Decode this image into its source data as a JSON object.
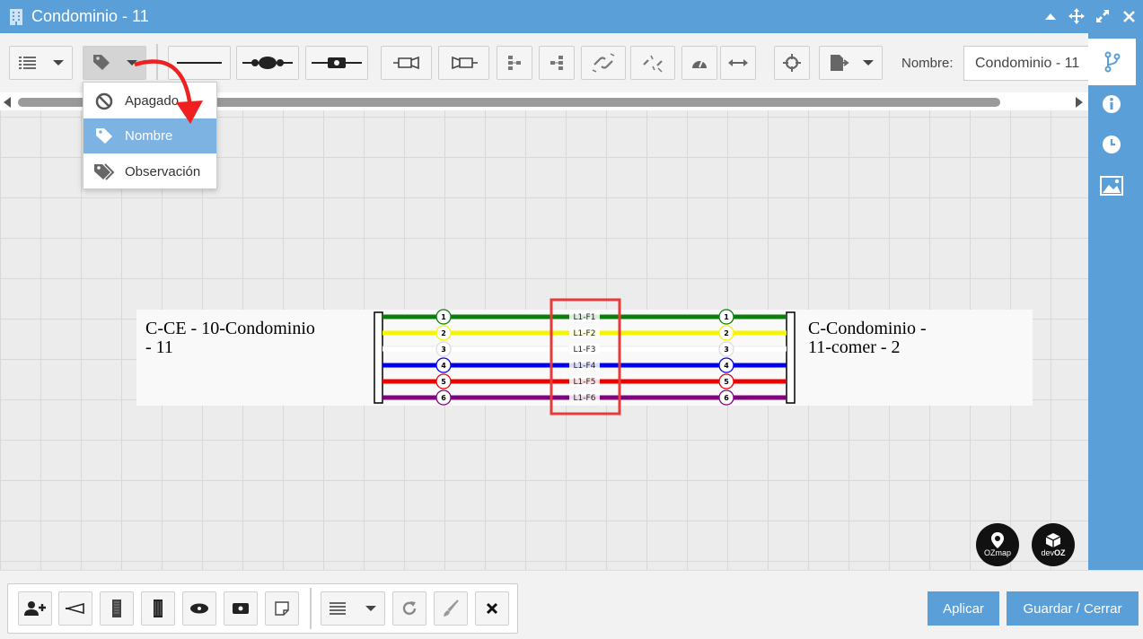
{
  "window": {
    "title": "Condominio - 11"
  },
  "toolbar": {
    "name_label": "Nombre:",
    "name_value": "Condominio - 11"
  },
  "dropdown": {
    "items": [
      {
        "label": "Apagado"
      },
      {
        "label": "Nombre"
      },
      {
        "label": "Observación"
      }
    ]
  },
  "diagram": {
    "left_label": [
      "C-CE - 10-Condominio",
      "- 11"
    ],
    "right_label": [
      "C-Condominio -",
      "11-comer - 2"
    ],
    "fibers": [
      {
        "num": "1",
        "name": "L1-F1",
        "color": "#0a7d0a"
      },
      {
        "num": "2",
        "name": "L1-F2",
        "color": "#f5f500"
      },
      {
        "num": "3",
        "name": "L1-F3",
        "color": "#ffffff"
      },
      {
        "num": "4",
        "name": "L1-F4",
        "color": "#0000ee"
      },
      {
        "num": "5",
        "name": "L1-F5",
        "color": "#ee0000"
      },
      {
        "num": "6",
        "name": "L1-F6",
        "color": "#800080"
      }
    ],
    "highlight_color": "#e83a3a"
  },
  "logos": {
    "ozmap": "OZmap",
    "devoz_prefix": "dev",
    "devoz_suffix": "OZ"
  },
  "footer": {
    "apply": "Aplicar",
    "save_close": "Guardar / Cerrar"
  },
  "colors": {
    "accent": "#5b9fd8",
    "selected_item": "#7db3e3"
  }
}
